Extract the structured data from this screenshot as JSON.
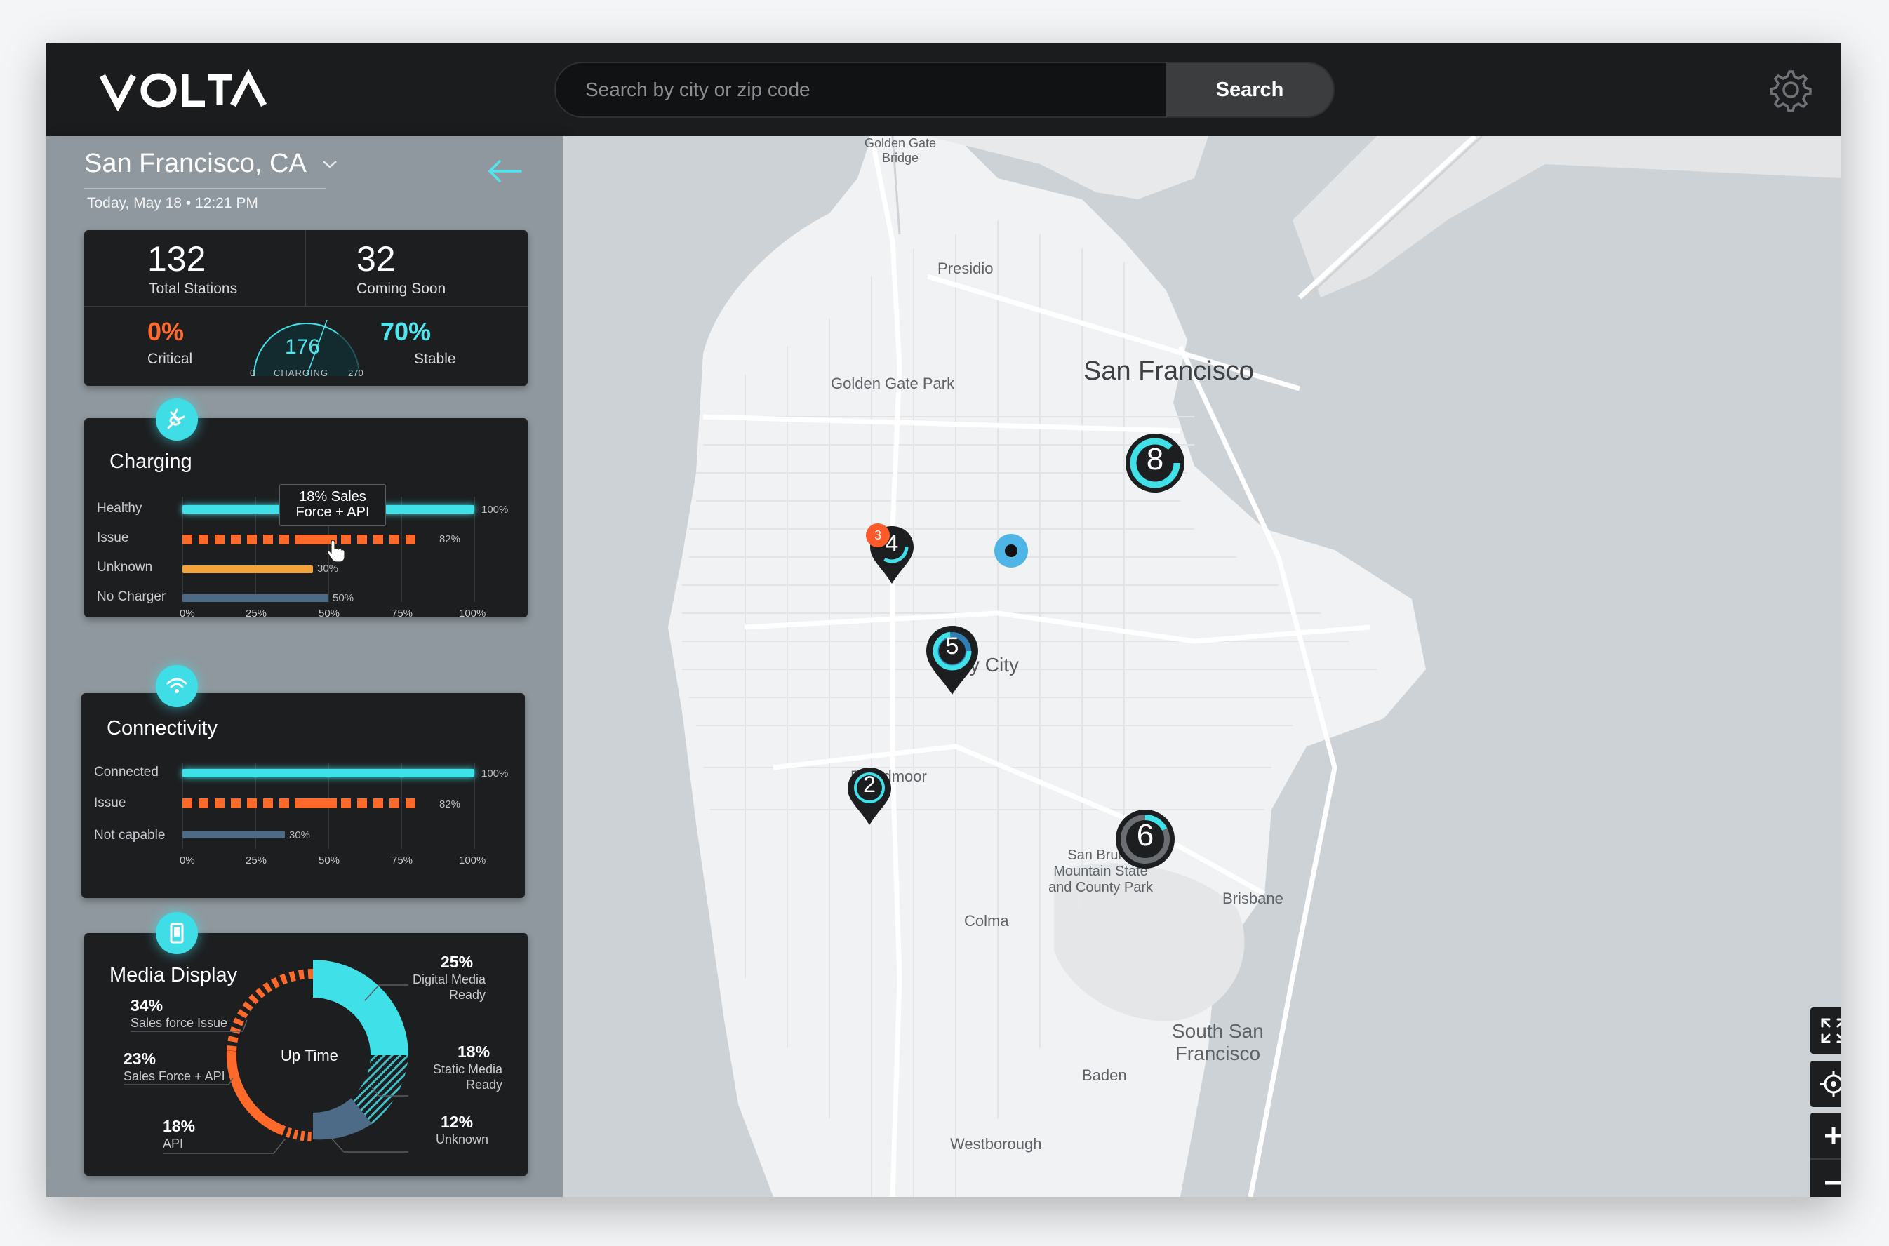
{
  "header": {
    "logo": "VOLTA",
    "search_placeholder": "Search by city or zip code",
    "search_button": "Search"
  },
  "sidebar": {
    "city": "San Francisco, CA",
    "datetime": "Today, May 18 • 12:21 PM",
    "stats": {
      "total_stations": "132",
      "total_stations_label": "Total Stations",
      "coming_soon": "32",
      "coming_soon_label": "Coming Soon",
      "critical": "0%",
      "critical_label": "Critical",
      "stable": "70%",
      "stable_label": "Stable",
      "charging_value": "176",
      "charging_label": "CHARGING",
      "gauge_min": "0",
      "gauge_max": "270"
    },
    "charging": {
      "title": "Charging",
      "tooltip_line1": "18% Sales",
      "tooltip_line2": "Force + API",
      "rows": [
        {
          "label": "Healthy",
          "value": 100,
          "pct": "100%"
        },
        {
          "label": "Issue",
          "value": 82,
          "pct": "82%"
        },
        {
          "label": "Unknown",
          "value": 30,
          "pct": "30%"
        },
        {
          "label": "No Charger",
          "value": 50,
          "pct": "50%"
        }
      ],
      "ticks": [
        "0%",
        "25%",
        "50%",
        "75%",
        "100%"
      ]
    },
    "connectivity": {
      "title": "Connectivity",
      "rows": [
        {
          "label": "Connected",
          "value": 100,
          "pct": "100%"
        },
        {
          "label": "Issue",
          "value": 82,
          "pct": "82%"
        },
        {
          "label": "Not capable",
          "value": 30,
          "pct": "30%"
        }
      ],
      "ticks": [
        "0%",
        "25%",
        "50%",
        "75%",
        "100%"
      ]
    },
    "media": {
      "title": "Media Display",
      "center": "Up Time",
      "items": [
        {
          "pct": "25%",
          "label1": "Digital Media",
          "label2": "Ready"
        },
        {
          "pct": "18%",
          "label1": "Static Media",
          "label2": "Ready"
        },
        {
          "pct": "12%",
          "label1": "Unknown",
          "label2": ""
        },
        {
          "pct": "34%",
          "label1": "Sales force Issue",
          "label2": ""
        },
        {
          "pct": "23%",
          "label1": "Sales Force + API",
          "label2": ""
        },
        {
          "pct": "18%",
          "label1": "API",
          "label2": ""
        }
      ]
    }
  },
  "map": {
    "places": {
      "golden_gate_bridge": "Golden Gate\nBridge",
      "presidio": "Presidio",
      "san_francisco": "San Francisco",
      "golden_gate_park": "Golden Gate Park",
      "daly_city": "Daly City",
      "broadmoor": "Broadmoor",
      "san_bruno": "San Bruno\nMountain State\nand County Park",
      "brisbane": "Brisbane",
      "colma": "Colma",
      "south_sf": "South San\nFrancisco",
      "baden": "Baden",
      "westborough": "Westborough"
    },
    "markers": {
      "m8": "8",
      "m4": "4",
      "m4_alert": "3",
      "m5": "5",
      "m2": "2",
      "m6": "6"
    }
  },
  "colors": {
    "accent": "#3fe0e8",
    "warning": "#ff6a2b",
    "amber": "#f3a33a",
    "slate": "#4d6a86",
    "dark": "#1d1e20"
  }
}
